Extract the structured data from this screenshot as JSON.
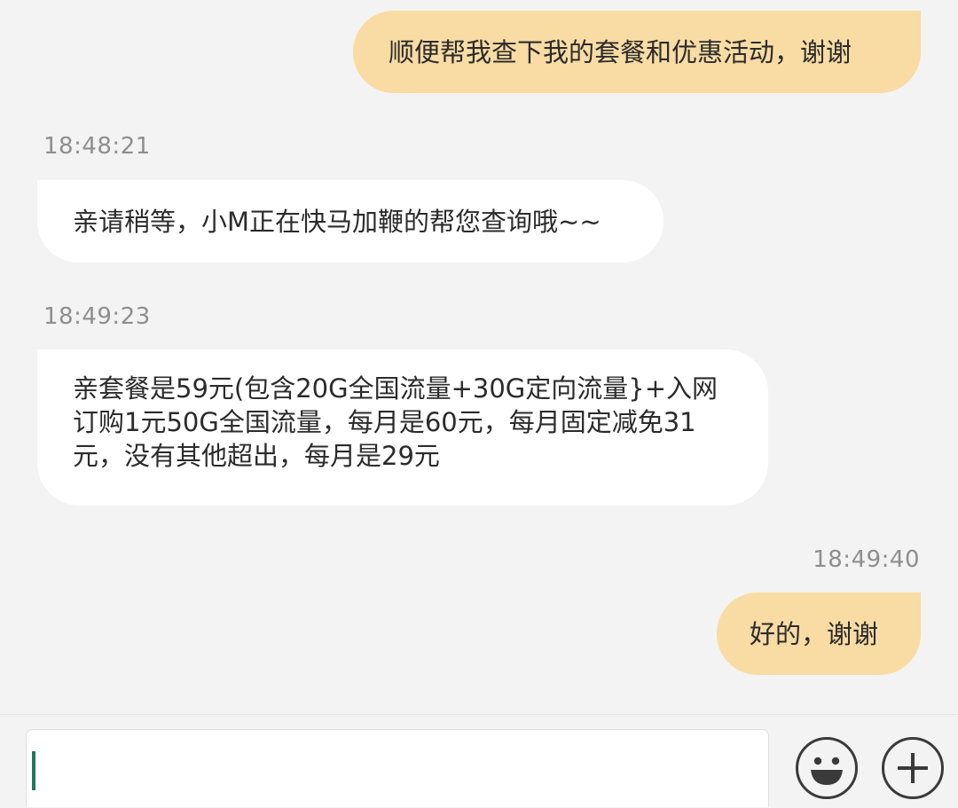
{
  "messages": [
    {
      "direction": "out",
      "text": "顺便帮我查下我的套餐和优惠活动，谢谢"
    },
    {
      "direction": "in",
      "timestamp": "18:48:21",
      "text": "亲请稍等，小M正在快马加鞭的帮您查询哦~~"
    },
    {
      "direction": "in",
      "timestamp": "18:49:23",
      "text": "亲套餐是59元(包含20G全国流量+30G定向流量}+入网\n订购1元50G全国流量，每月是60元，每月固定减免31\n元，没有其他超出，每月是29元"
    },
    {
      "direction": "out",
      "timestamp": "18:49:40",
      "text": "好的，谢谢"
    }
  ],
  "input": {
    "value": ""
  },
  "icons": {
    "emoji": "smiley-face-icon",
    "plus": "plus-icon"
  },
  "colors": {
    "background": "#f3f3f3",
    "outgoing_bubble": "#f9dca4",
    "incoming_bubble": "#ffffff",
    "timestamp_text": "#8e8e8e",
    "caret": "#1f7a5c"
  }
}
